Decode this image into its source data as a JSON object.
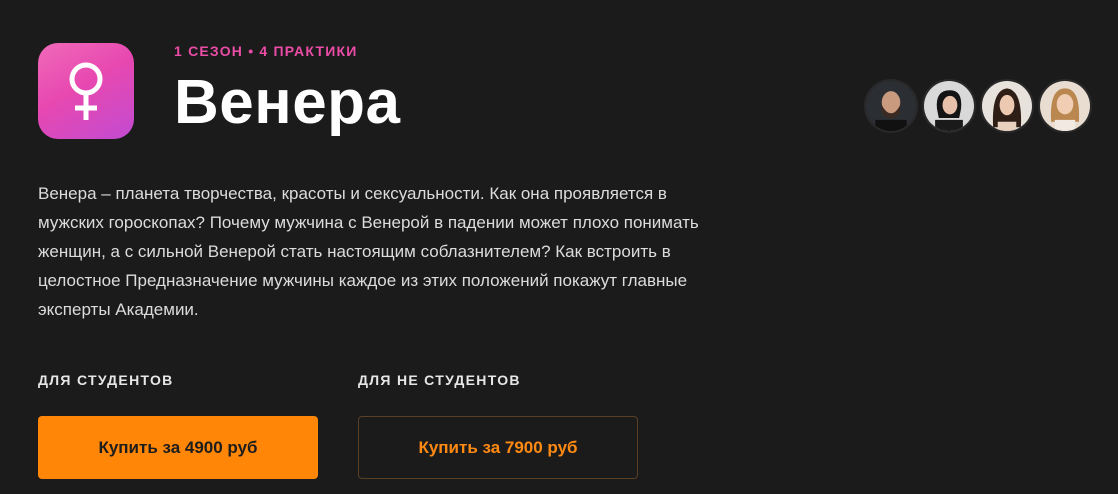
{
  "course": {
    "season_label": "1 СЕЗОН • 4 ПРАКТИКИ",
    "title": "Венера",
    "icon": "venus-symbol-icon",
    "description": "Венера – планета творчества, красоты и сексуальности. Как она проявляется в мужских гороскопах? Почему мужчина с Венерой в падении может плохо понимать женщин, а с сильной Венерой стать настоящим соблазнителем? Как встроить в целостное Предназначение мужчины каждое из этих положений покажут главные эксперты Академии."
  },
  "experts": [
    {
      "avatar": "expert-avatar-1"
    },
    {
      "avatar": "expert-avatar-2"
    },
    {
      "avatar": "expert-avatar-3"
    },
    {
      "avatar": "expert-avatar-4"
    }
  ],
  "pricing": {
    "students": {
      "label": "ДЛЯ СТУДЕНТОВ",
      "button": "Купить за 4900 руб"
    },
    "non_students": {
      "label": "ДЛЯ НЕ СТУДЕНТОВ",
      "button": "Купить за 7900 руб"
    }
  },
  "colors": {
    "background": "#1c1b1c",
    "accent_pink": "#ea4ca6",
    "accent_orange": "#ff8606"
  }
}
